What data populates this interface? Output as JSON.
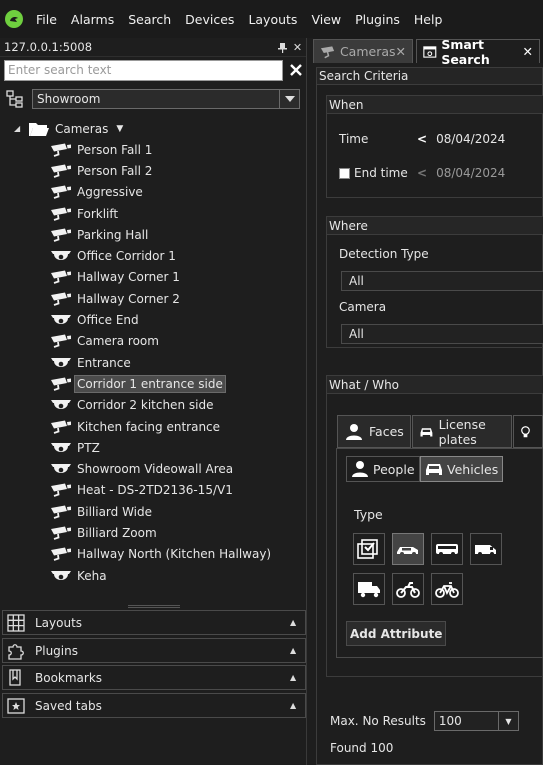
{
  "menu": {
    "items": [
      {
        "label": "File"
      },
      {
        "label": "Alarms"
      },
      {
        "label": "Search"
      },
      {
        "label": "Devices"
      },
      {
        "label": "Layouts"
      },
      {
        "label": "View"
      },
      {
        "label": "Plugins"
      },
      {
        "label": "Help"
      }
    ]
  },
  "left_panel": {
    "server": "127.0.0.1:5008",
    "search_placeholder": "Enter search text",
    "site": "Showroom",
    "tree_root": "Cameras",
    "cameras": [
      {
        "label": "Person Fall 1",
        "kind": "bullet"
      },
      {
        "label": "Person Fall 2",
        "kind": "bullet"
      },
      {
        "label": "Aggressive",
        "kind": "bullet"
      },
      {
        "label": "Forklift",
        "kind": "bullet"
      },
      {
        "label": "Parking Hall",
        "kind": "bullet"
      },
      {
        "label": "Office Corridor 1",
        "kind": "dome"
      },
      {
        "label": "Hallway Corner 1",
        "kind": "bullet"
      },
      {
        "label": "Hallway Corner 2",
        "kind": "bullet"
      },
      {
        "label": "Office End",
        "kind": "dome"
      },
      {
        "label": "Camera room",
        "kind": "bullet"
      },
      {
        "label": "Entrance",
        "kind": "dome"
      },
      {
        "label": "Corridor 1 entrance side",
        "kind": "bullet",
        "selected": true
      },
      {
        "label": "Corridor 2 kitchen side",
        "kind": "dome"
      },
      {
        "label": "Kitchen facing entrance",
        "kind": "bullet"
      },
      {
        "label": "PTZ",
        "kind": "dome"
      },
      {
        "label": "Showroom Videowall Area",
        "kind": "dome"
      },
      {
        "label": "Heat - DS-2TD2136-15/V1",
        "kind": "bullet"
      },
      {
        "label": "Billiard Wide",
        "kind": "bullet"
      },
      {
        "label": "Billiard Zoom",
        "kind": "bullet"
      },
      {
        "label": "Hallway North (Kitchen Hallway)",
        "kind": "bullet"
      },
      {
        "label": "Keha",
        "kind": "dome"
      }
    ],
    "accordion": [
      {
        "label": "Layouts",
        "icon": "grid-icon"
      },
      {
        "label": "Plugins",
        "icon": "puzzle-icon"
      },
      {
        "label": "Bookmarks",
        "icon": "bookmark-icon"
      },
      {
        "label": "Saved tabs",
        "icon": "saved-tab-icon"
      }
    ]
  },
  "tabs": {
    "cameras": "Cameras",
    "smart_search": "Smart Search"
  },
  "criteria": {
    "title": "Search Criteria",
    "when": {
      "title": "When",
      "time_label": "Time",
      "time_value": "08/04/2024",
      "end_time_label": "End time",
      "end_time_value": "08/04/2024",
      "end_time_checked": false
    },
    "where": {
      "title": "Where",
      "detection_type_label": "Detection Type",
      "detection_type_value": "All",
      "camera_label": "Camera",
      "camera_value": "All"
    },
    "what": {
      "title": "What / Who",
      "tab_faces": "Faces",
      "tab_plates": "License plates",
      "people": "People",
      "vehicles": "Vehicles",
      "type_label": "Type",
      "add_attribute": "Add Attribute"
    },
    "max_results_label": "Max. No Results",
    "max_results_value": "100",
    "found": "Found 100"
  },
  "colors": {
    "accent_green": "#6fcf3f",
    "background": "#1e1e1e",
    "text": "#e6e6e6"
  }
}
